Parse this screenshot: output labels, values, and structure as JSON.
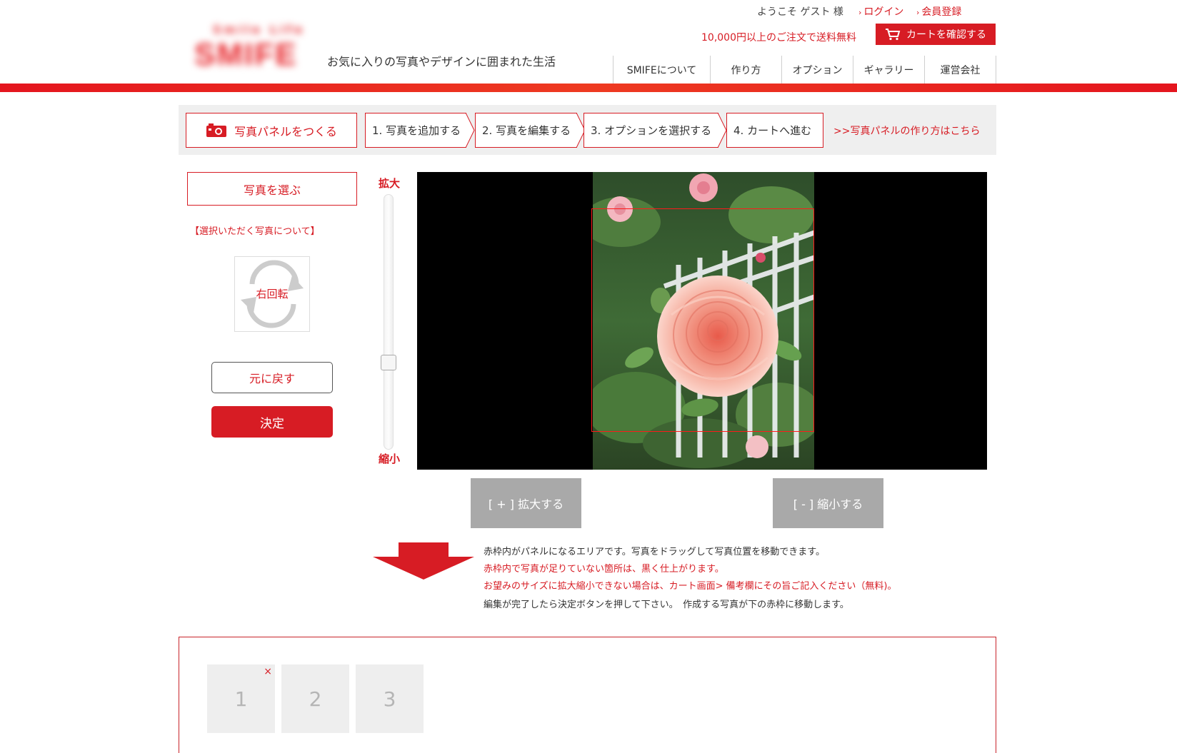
{
  "header": {
    "logo_small": "Smile Life",
    "logo_text": "SMIFE",
    "tagline": "お気に入りの写真やデザインに囲まれた生活",
    "welcome": "ようこそ ゲスト 様",
    "login": "ログイン",
    "register": "会員登録",
    "free_shipping": "10,000円以上のご注文で送料無料",
    "cart_button": "カートを確認する",
    "nav": [
      "SMIFEについて",
      "作り方",
      "オプション",
      "ギャラリー",
      "運営会社"
    ]
  },
  "steps": {
    "title": "写真パネルをつくる",
    "items": [
      "1. 写真を追加する",
      "2. 写真を編集する",
      "3. オプションを選択する",
      "4. カートへ進む"
    ],
    "howto_link": ">>写真パネルの作り方はこちら"
  },
  "controls": {
    "choose_photo": "写真を選ぶ",
    "about_photos": "【選択いただく写真について】",
    "rotate": "右回転",
    "reset": "元に戻す",
    "decide": "決定"
  },
  "zoom": {
    "label_in": "拡大",
    "label_out": "縮小",
    "level": 0.33,
    "enlarge_button": "[ + ] 拡大する",
    "shrink_button": "[ - ] 縮小する"
  },
  "notes": {
    "line1": "赤枠内がパネルになるエリアです。写真をドラッグして写真位置を移動できます。",
    "line2": "赤枠内で写真が足りていない箇所は、黒く仕上がります。",
    "line3": "お望みのサイズに拡大縮小できない場合は、カート画面> 備考欄にその旨ご記入ください（無料)。",
    "line4": "編集が完了したら決定ボタンを押して下さい。　作成する写真が下の赤枠に移動します。"
  },
  "tray": {
    "slots": [
      "1",
      "2",
      "3"
    ],
    "remove_mark": "×"
  },
  "colors": {
    "accent": "#d71c24",
    "header_bar": "#e4151e",
    "button_gray": "#a9a9a9",
    "steps_bg": "#efefef",
    "slot_bg": "#eeeeee"
  }
}
